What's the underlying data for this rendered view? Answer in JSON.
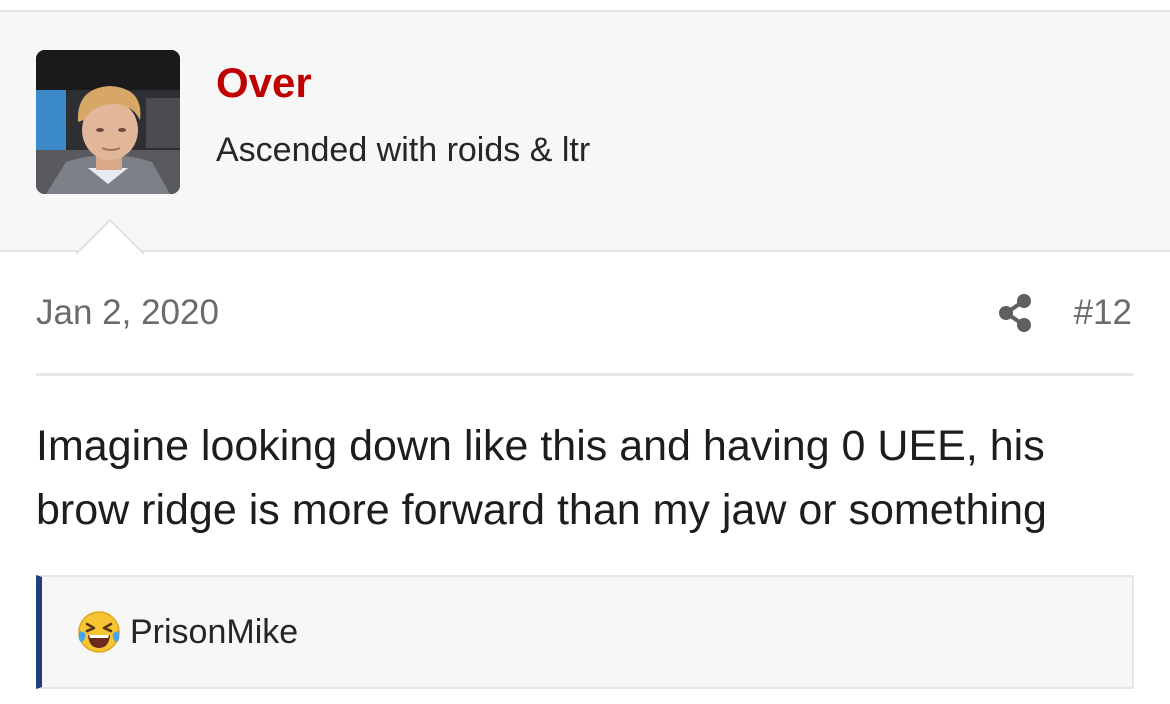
{
  "user": {
    "name": "Over",
    "title": "Ascended with roids & ltr",
    "avatar_icon": "user-avatar-photo",
    "name_color": "#c00000"
  },
  "post": {
    "date": "Jan 2, 2020",
    "number": "#12",
    "share_icon": "share-icon",
    "body": "Imagine looking down like this and having 0 UEE, his brow ridge is more forward than my jaw or something"
  },
  "reactions": {
    "emoji_icon": "laughing-tears-emoji-icon",
    "user": "PrisonMike",
    "accent_color": "#1f3f7a"
  }
}
